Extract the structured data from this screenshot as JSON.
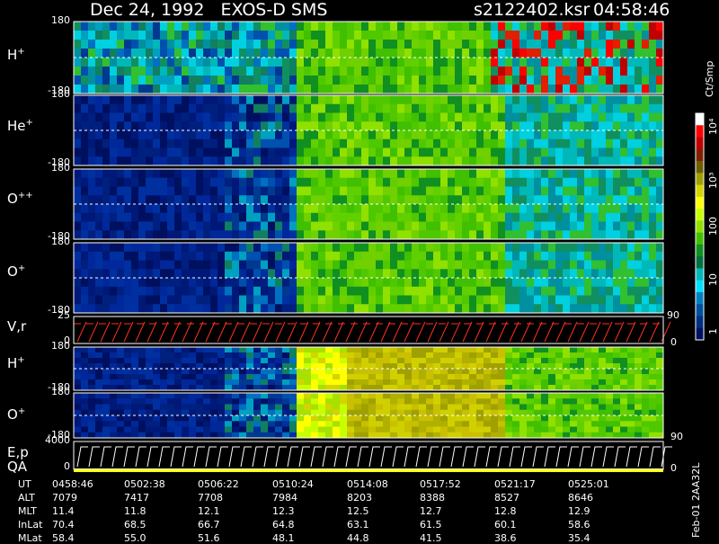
{
  "header": {
    "title": "Dec 24, 1992   EXOS-D SMS",
    "file": "s2122402.ksr",
    "time": "04:58:46"
  },
  "chart_data": {
    "type": "heatmap",
    "panels": [
      {
        "label": "H",
        "sup": "+",
        "top_tick": "180",
        "bottom_tick": "-180"
      },
      {
        "label": "He",
        "sup": "+",
        "top_tick": "180",
        "bottom_tick": "-180"
      },
      {
        "label": "O",
        "sup": "++",
        "top_tick": "180",
        "bottom_tick": "-180"
      },
      {
        "label": "O",
        "sup": "+",
        "top_tick": "180",
        "bottom_tick": "-180"
      },
      {
        "label": "V,r",
        "sup": "",
        "top_tick": "25",
        "bottom_tick": "0",
        "right_top": "90",
        "right_bottom": "0"
      },
      {
        "label": "H",
        "sup": "+",
        "top_tick": "180",
        "bottom_tick": "-180"
      },
      {
        "label": "O",
        "sup": "+",
        "top_tick": "180",
        "bottom_tick": "-180",
        "right_bottom": "90"
      },
      {
        "label": "E,p",
        "sup": "",
        "top_tick": "4000",
        "bottom_tick": "0",
        "right_bottom": "0"
      }
    ],
    "qa_label": "QA",
    "colorbar": {
      "unit": "Ct/Smp",
      "ticks": [
        "10⁴",
        "10³",
        "100",
        "10",
        "1"
      ],
      "colors": [
        "#ffffff",
        "#ff0000",
        "#c00000",
        "#802000",
        "#6e5e00",
        "#a0a000",
        "#d4d400",
        "#ffff00",
        "#c8ff00",
        "#90e000",
        "#40c000",
        "#109020",
        "#007040",
        "#00b8b8",
        "#00e0ff",
        "#0080c0",
        "#0050a0",
        "#003080",
        "#001060"
      ]
    },
    "table": {
      "rows": [
        {
          "name": "UT",
          "values": [
            "0458:46",
            "0502:38",
            "0506:22",
            "0510:24",
            "0514:08",
            "0517:52",
            "0521:17",
            "0525:01"
          ]
        },
        {
          "name": "ALT",
          "values": [
            "7079",
            "7417",
            "7708",
            "7984",
            "8203",
            "8388",
            "8527",
            "8646"
          ]
        },
        {
          "name": "MLT",
          "values": [
            "11.4",
            "11.8",
            "12.1",
            "12.3",
            "12.5",
            "12.7",
            "12.8",
            "12.9"
          ]
        },
        {
          "name": "InLat",
          "values": [
            "70.4",
            "68.5",
            "66.7",
            "64.8",
            "63.1",
            "61.5",
            "60.1",
            "58.6"
          ]
        },
        {
          "name": "MLat",
          "values": [
            "58.4",
            "55.0",
            "51.6",
            "48.1",
            "44.8",
            "41.5",
            "38.6",
            "35.4"
          ]
        }
      ]
    }
  },
  "footer": {
    "stamp": "Feb-01 2AA32L"
  }
}
